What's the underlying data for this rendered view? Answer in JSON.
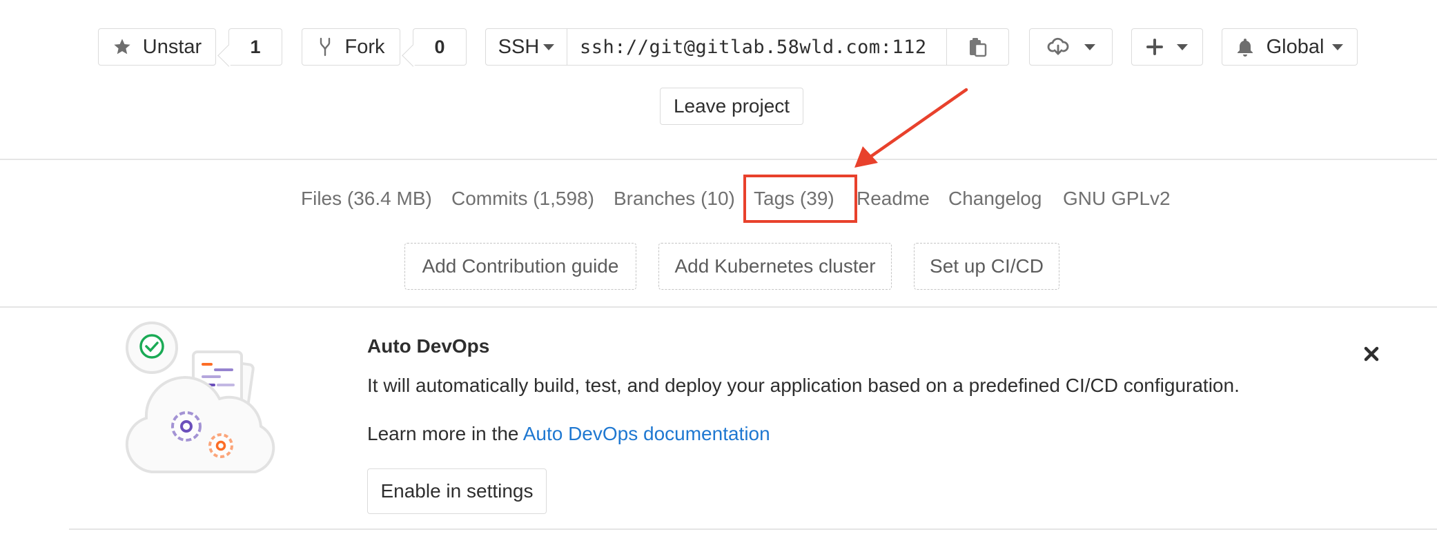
{
  "header": {
    "star": {
      "label": "Unstar",
      "count": "1"
    },
    "fork": {
      "label": "Fork",
      "count": "0"
    },
    "clone": {
      "protocol": "SSH",
      "url": "ssh://git@gitlab.58wld.com:112"
    },
    "notification": {
      "label": "Global"
    },
    "leave_label": "Leave project"
  },
  "stats_nav": {
    "files": "Files (36.4 MB)",
    "commits": "Commits (1,598)",
    "branches": "Branches (10)",
    "tags": "Tags (39)",
    "readme": "Readme",
    "changelog": "Changelog",
    "license": "GNU GPLv2"
  },
  "quick_actions": {
    "contribution": "Add Contribution guide",
    "kubernetes": "Add Kubernetes cluster",
    "cicd": "Set up CI/CD"
  },
  "auto_devops": {
    "title": "Auto DevOps",
    "description": "It will automatically build, test, and deploy your application based on a predefined CI/CD configuration.",
    "learn_prefix": "Learn more in the ",
    "learn_link": "Auto DevOps documentation",
    "enable_label": "Enable in settings"
  },
  "colors": {
    "annotation_red": "#e8412c",
    "link_blue": "#1f78d1",
    "check_green": "#1aaa55"
  }
}
